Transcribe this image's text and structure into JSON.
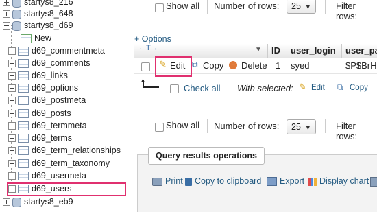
{
  "sidebar": {
    "items": [
      {
        "label": "startys8_216",
        "kind": "db"
      },
      {
        "label": "startys8_648",
        "kind": "db"
      },
      {
        "label": "startys8_d69",
        "kind": "db"
      },
      {
        "label": "New",
        "kind": "new"
      },
      {
        "label": "d69_commentmeta",
        "kind": "table"
      },
      {
        "label": "d69_comments",
        "kind": "table"
      },
      {
        "label": "d69_links",
        "kind": "table"
      },
      {
        "label": "d69_options",
        "kind": "table"
      },
      {
        "label": "d69_postmeta",
        "kind": "table"
      },
      {
        "label": "d69_posts",
        "kind": "table"
      },
      {
        "label": "d69_termmeta",
        "kind": "table"
      },
      {
        "label": "d69_terms",
        "kind": "table"
      },
      {
        "label": "d69_term_relationships",
        "kind": "table"
      },
      {
        "label": "d69_term_taxonomy",
        "kind": "table"
      },
      {
        "label": "d69_usermeta",
        "kind": "table"
      },
      {
        "label": "d69_users",
        "kind": "table",
        "highlighted": true
      },
      {
        "label": "startys8_eb9",
        "kind": "db"
      }
    ]
  },
  "nav_top": {
    "show_all_label": "Show all",
    "rows_label": "Number of rows:",
    "rows_value": "25",
    "filter_label": "Filter rows:"
  },
  "results": {
    "options_link": "+ Options",
    "columns": [
      "ID",
      "user_login",
      "user_pa"
    ],
    "row": {
      "edit_label": "Edit",
      "copy_label": "Copy",
      "delete_label": "Delete",
      "id": "1",
      "user_login": "syed",
      "user_pass": "$P$BrH."
    },
    "check_all_label": "Check all",
    "with_selected_label": "With selected:",
    "ws_edit_label": "Edit",
    "ws_copy_label": "Copy"
  },
  "nav_bottom": {
    "show_all_label": "Show all",
    "rows_label": "Number of rows:",
    "rows_value": "25",
    "filter_label": "Filter rows:"
  },
  "query_ops": {
    "title": "Query results operations",
    "print_label": "Print",
    "copy_clipboard_label": "Copy to clipboard",
    "export_label": "Export",
    "display_chart_label": "Display chart"
  },
  "colors": {
    "highlight": "#e0306f",
    "link": "#235a81"
  }
}
